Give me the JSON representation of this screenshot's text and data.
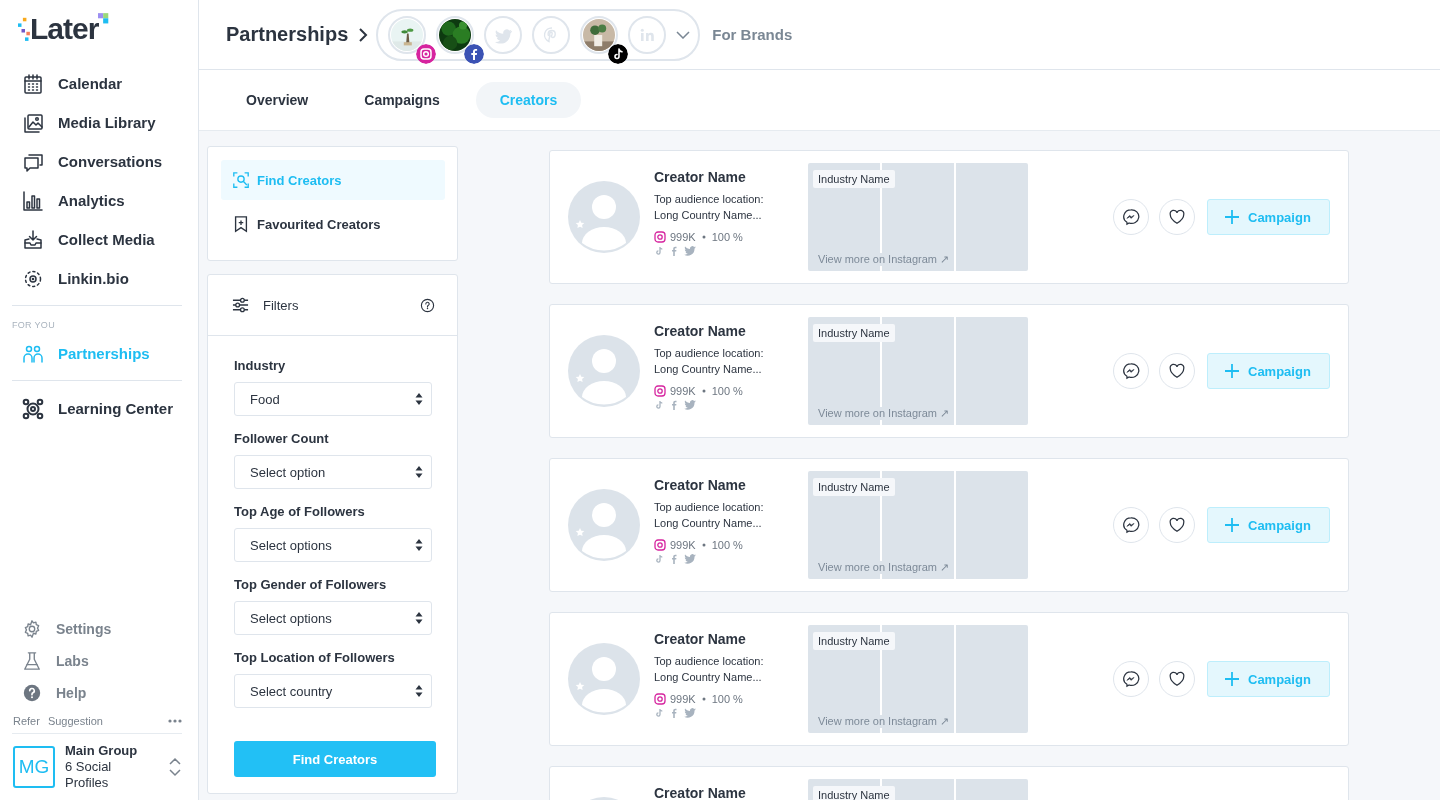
{
  "logo": {
    "text": "Later"
  },
  "sidebar": {
    "groups": [
      {
        "items": [
          {
            "label": "Calendar",
            "selected": false
          },
          {
            "label": "Media Library",
            "selected": false
          },
          {
            "label": "Conversations",
            "selected": false
          },
          {
            "label": "Analytics",
            "selected": false
          },
          {
            "label": "Collect Media",
            "selected": false
          },
          {
            "label": "Linkin.bio",
            "selected": false
          }
        ]
      },
      {
        "label": "FOR YOU",
        "items": [
          {
            "label": "Partnerships",
            "selected": true
          }
        ]
      },
      {
        "items": [
          {
            "label": "Learning Center",
            "selected": false
          }
        ]
      }
    ],
    "bottom_items": [
      "Settings",
      "Labs",
      "Help"
    ],
    "footer_links": [
      "Refer",
      "Suggestion"
    ],
    "account": {
      "initials": "MG",
      "name": "Main Group",
      "profiles": "6 Social Profiles"
    }
  },
  "header": {
    "title": "Partnerships",
    "profiles": [
      {
        "connected": true
      },
      {
        "connected": true
      },
      {
        "connected": false
      },
      {
        "connected": false
      },
      {
        "connected": true
      },
      {
        "connected": false
      }
    ],
    "brand_link": "For Brands"
  },
  "tabs": [
    {
      "label": "Overview",
      "selected": false
    },
    {
      "label": "Campaigns",
      "selected": false
    },
    {
      "label": "Creators",
      "selected": true
    }
  ],
  "panel": {
    "menu": [
      {
        "label": "Find Creators",
        "selected": true
      },
      {
        "label": "Favourited Creators",
        "selected": false
      }
    ],
    "filters_title": "Filters",
    "filters": [
      {
        "label": "Industry",
        "value": "Food"
      },
      {
        "label": "Follower Count",
        "value": "Select option"
      },
      {
        "label": "Top Age of Followers",
        "value": "Select options"
      },
      {
        "label": "Top Gender of Followers",
        "value": "Select options"
      },
      {
        "label": "Top Location of Followers",
        "value": "Select country"
      }
    ],
    "button": "Find Creators"
  },
  "creators": [
    {
      "name": "Creator Name",
      "location_label": "Top audience location:",
      "location": "Long Country Name...",
      "followers": "999K",
      "rate": "100 %",
      "industry": "Industry Name",
      "link": "View more on Instagram ↗",
      "action": "Campaign"
    },
    {
      "name": "Creator Name",
      "location_label": "Top audience location:",
      "location": "Long Country Name...",
      "followers": "999K",
      "rate": "100 %",
      "industry": "Industry Name",
      "link": "View more on Instagram ↗",
      "action": "Campaign"
    },
    {
      "name": "Creator Name",
      "location_label": "Top audience location:",
      "location": "Long Country Name...",
      "followers": "999K",
      "rate": "100 %",
      "industry": "Industry Name",
      "link": "View more on Instagram ↗",
      "action": "Campaign"
    },
    {
      "name": "Creator Name",
      "location_label": "Top audience location:",
      "location": "Long Country Name...",
      "followers": "999K",
      "rate": "100 %",
      "industry": "Industry Name",
      "link": "View more on Instagram ↗",
      "action": "Campaign"
    },
    {
      "name": "Creator Name",
      "industry": "Industry Name"
    }
  ]
}
